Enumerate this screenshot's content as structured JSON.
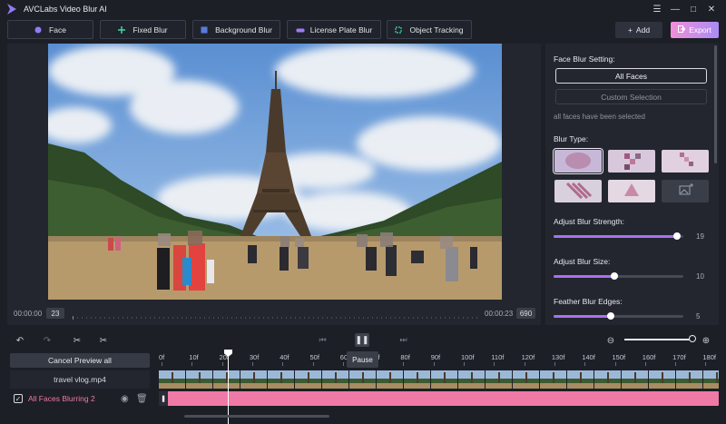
{
  "app": {
    "title": "AVCLabs Video Blur AI"
  },
  "window_controls": {
    "menu": "☰",
    "minimize": "—",
    "maximize": "□",
    "close": "✕"
  },
  "modes": [
    {
      "label": "Face",
      "icon": "face-icon"
    },
    {
      "label": "Fixed Blur",
      "icon": "crosshair-icon"
    },
    {
      "label": "Background Blur",
      "icon": "background-icon"
    },
    {
      "label": "License Plate Blur",
      "icon": "car-icon"
    },
    {
      "label": "Object Tracking",
      "icon": "tracking-icon"
    }
  ],
  "toolbar": {
    "add_label": "Add",
    "export_label": "Export"
  },
  "preview": {
    "time_start": "00:00:00",
    "frame_start": "23",
    "time_end": "00:00:23",
    "frame_end": "690"
  },
  "settings": {
    "face_blur_title": "Face Blur Setting:",
    "all_faces": "All Faces",
    "custom_selection": "Custom Selection",
    "note": "all faces have been selected",
    "blur_type_title": "Blur Type:",
    "strength_label": "Adjust Blur Strength:",
    "strength_value": "19",
    "strength_fraction": 0.95,
    "size_label": "Adjust Blur Size:",
    "size_value": "10",
    "size_fraction": 0.47,
    "feather_label": "Feather Blur Edges:",
    "feather_value": "5",
    "feather_fraction": 0.44
  },
  "timeline": {
    "cancel_preview": "Cancel Preview all",
    "track_file": "travel vlog.mp4",
    "blur_track": "All Faces Blurring 2",
    "pause_tooltip": "Pause",
    "ticks": [
      "0f",
      "10f",
      "20f",
      "30f",
      "40f",
      "50f",
      "60f",
      "70f",
      "80f",
      "90f",
      "100f",
      "110f",
      "120f",
      "130f",
      "140f",
      "150f",
      "160f",
      "170f",
      "180f"
    ],
    "zoom_fraction": 0.97
  },
  "colors": {
    "accent": "#a970f0",
    "export_start": "#f28fd8",
    "export_end": "#a98cf5",
    "blur_track": "#f07aa6",
    "blur_label": "#f07aa6"
  }
}
